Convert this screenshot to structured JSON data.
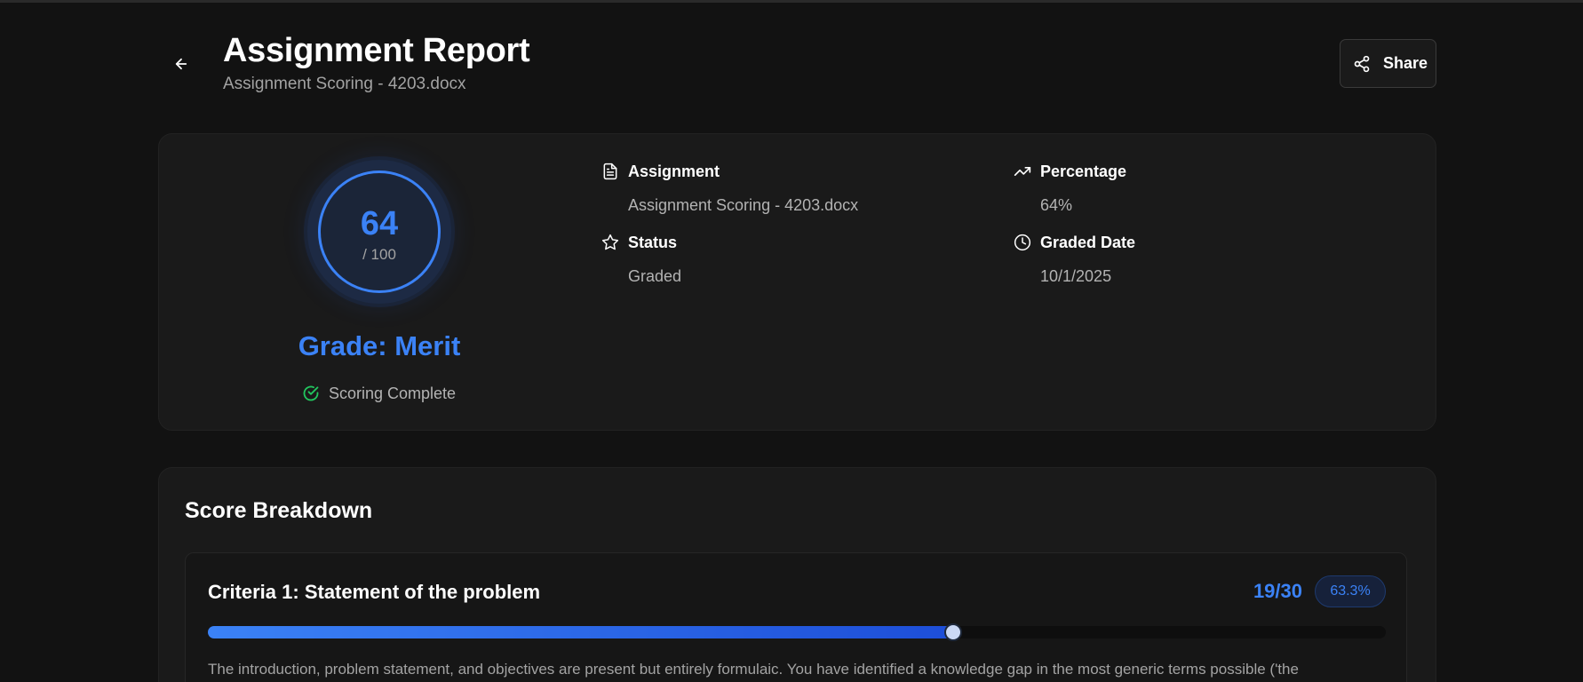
{
  "header": {
    "title": "Assignment Report",
    "subtitle": "Assignment Scoring - 4203.docx",
    "share_label": "Share"
  },
  "summary": {
    "score": "64",
    "score_total": "/ 100",
    "grade": "Grade: Merit",
    "status_line": "Scoring Complete",
    "accent_color": "#3b82f6",
    "success_color": "#22c55e",
    "meta": {
      "assignment_label": "Assignment",
      "assignment_value": "Assignment Scoring - 4203.docx",
      "percentage_label": "Percentage",
      "percentage_value": "64%",
      "status_label": "Status",
      "status_value": "Graded",
      "graded_date_label": "Graded Date",
      "graded_date_value": "10/1/2025"
    }
  },
  "breakdown": {
    "title": "Score Breakdown",
    "criteria": [
      {
        "title": "Criteria 1: Statement of the problem",
        "score": "19/30",
        "percent_label": "63.3%",
        "progress_fraction": 0.633,
        "feedback": "The introduction, problem statement, and objectives are present but entirely formulaic. You have identified a knowledge gap in the most generic terms possible ('the"
      }
    ]
  },
  "icons": {
    "back": "arrow-left-icon",
    "share": "share-icon",
    "document": "file-text-icon",
    "trend": "trending-up-icon",
    "status": "star-icon",
    "clock": "clock-icon",
    "check": "check-circle-icon"
  }
}
